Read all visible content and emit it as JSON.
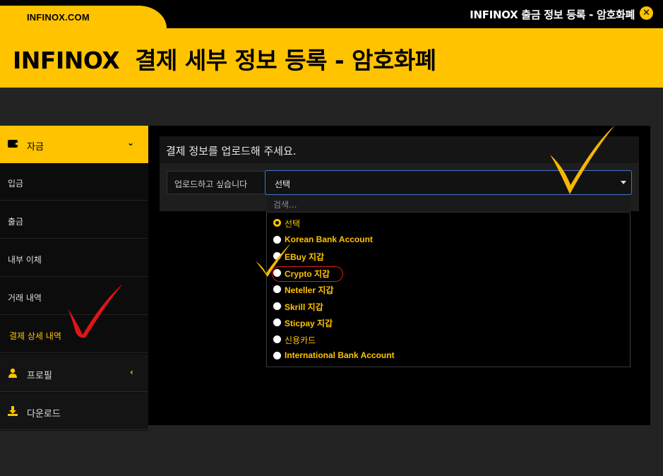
{
  "header": {
    "brand": "INFINOX.COM",
    "title": "INFINOX  결제 세부 정보 등록 - 암호화폐",
    "right_title": "INFINOX 출금 정보 등록 - 암호화폐",
    "close_icon": "close-circle-icon"
  },
  "sidebar": {
    "fund": {
      "label": "자금",
      "icon": "wallet-icon"
    },
    "items": [
      {
        "label": "입금"
      },
      {
        "label": "출금"
      },
      {
        "label": "내부 이체"
      },
      {
        "label": "거래 내역"
      },
      {
        "label": "결제 상세 내역"
      }
    ],
    "profile": {
      "label": "프로필",
      "icon": "user-icon"
    },
    "download": {
      "label": "다운로드",
      "icon": "download-icon"
    }
  },
  "main": {
    "panel_title": "결제 정보를 업로드해 주세요.",
    "upload_label": "업로드하고 싶습니다",
    "select_value": "선택",
    "search_placeholder": "검색...",
    "options": [
      {
        "label": "선택",
        "selected": true
      },
      {
        "label": "Korean Bank Account",
        "selected": false
      },
      {
        "label": "EBuy 지갑",
        "selected": false
      },
      {
        "label": "Crypto 지갑",
        "selected": false
      },
      {
        "label": "Neteller 지갑",
        "selected": false
      },
      {
        "label": "Skrill 지갑",
        "selected": false
      },
      {
        "label": "Sticpay 지갑",
        "selected": false
      },
      {
        "label": "신용카드",
        "selected": false
      },
      {
        "label": "International Bank Account",
        "selected": false
      }
    ]
  },
  "colors": {
    "accent": "#FFC300",
    "mark_red": "#d61f1f",
    "select_border": "#4a72c8"
  }
}
